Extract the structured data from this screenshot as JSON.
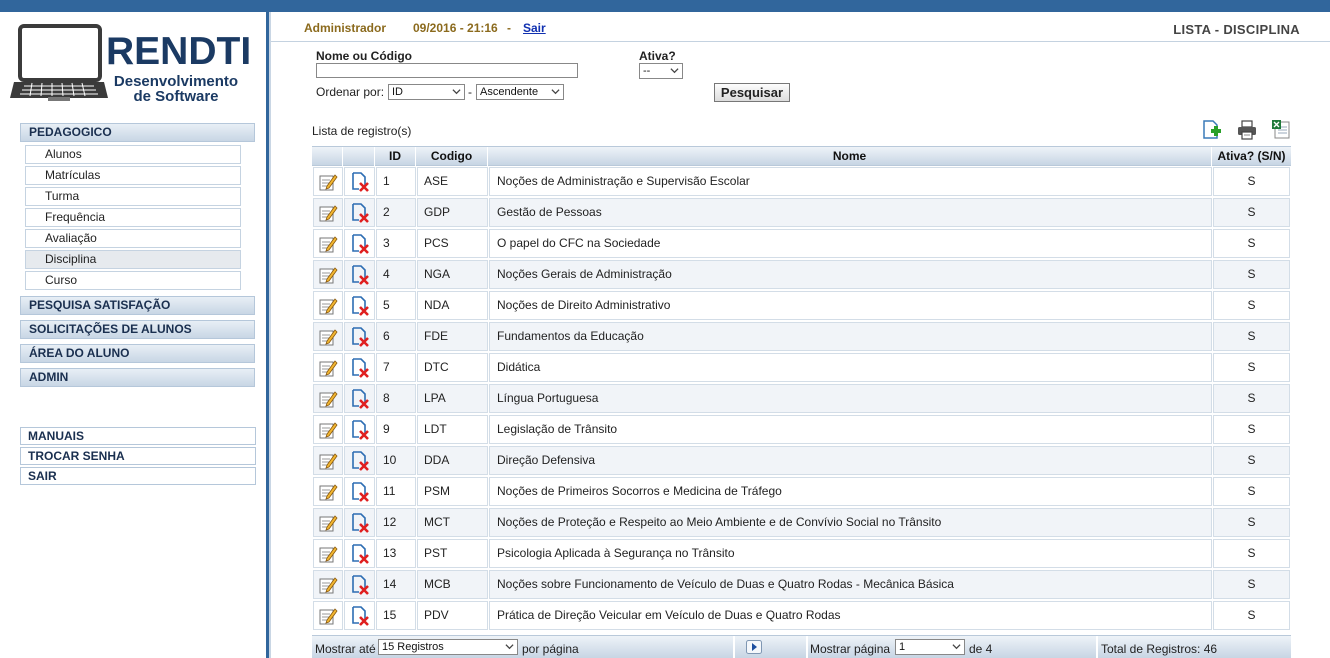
{
  "logo": {
    "title": "RENDTI",
    "subtitle_line1": "Desenvolvimento",
    "subtitle_line2": "de Software"
  },
  "sidebar": {
    "section_pedagogico": "PEDAGOGICO",
    "pedagogico_items": [
      "Alunos",
      "Matrículas",
      "Turma",
      "Frequência",
      "Avaliação",
      "Disciplina",
      "Curso"
    ],
    "active_item": "Disciplina",
    "section_pesquisa": "PESQUISA SATISFAÇÃO",
    "section_solicitacoes": "SOLICITAÇÕES DE ALUNOS",
    "section_area": "ÁREA DO ALUNO",
    "section_admin": "ADMIN",
    "bottom": [
      "MANUAIS",
      "TROCAR SENHA",
      "SAIR"
    ]
  },
  "topbar": {
    "user": "Administrador",
    "date": "09/2016 - 21:16",
    "separator": "-",
    "logout": "Sair",
    "page_title": "LISTA - DISCIPLINA"
  },
  "filters": {
    "name_label": "Nome ou Código",
    "name_value": "",
    "ativa_label": "Ativa?",
    "ativa_value": "--",
    "order_label": "Ordenar por:",
    "order_field": "ID",
    "order_sep": "-",
    "order_dir": "Ascendente",
    "search_button": "Pesquisar"
  },
  "list_caption": "Lista de registro(s)",
  "toolbar_icons": [
    "add-icon",
    "print-icon",
    "excel-icon"
  ],
  "table": {
    "columns": {
      "id": "ID",
      "codigo": "Codigo",
      "nome": "Nome",
      "ativa": "Ativa? (S/N)"
    },
    "rows": [
      {
        "id": "1",
        "codigo": "ASE",
        "nome": "Noções de Administração e Supervisão Escolar",
        "ativa": "S"
      },
      {
        "id": "2",
        "codigo": "GDP",
        "nome": "Gestão de Pessoas",
        "ativa": "S"
      },
      {
        "id": "3",
        "codigo": "PCS",
        "nome": "O papel do CFC na Sociedade",
        "ativa": "S"
      },
      {
        "id": "4",
        "codigo": "NGA",
        "nome": "Noções Gerais de Administração",
        "ativa": "S"
      },
      {
        "id": "5",
        "codigo": "NDA",
        "nome": "Noções de Direito Administrativo",
        "ativa": "S"
      },
      {
        "id": "6",
        "codigo": "FDE",
        "nome": "Fundamentos da Educação",
        "ativa": "S"
      },
      {
        "id": "7",
        "codigo": "DTC",
        "nome": "Didática",
        "ativa": "S"
      },
      {
        "id": "8",
        "codigo": "LPA",
        "nome": "Língua Portuguesa",
        "ativa": "S"
      },
      {
        "id": "9",
        "codigo": "LDT",
        "nome": "Legislação de Trânsito",
        "ativa": "S"
      },
      {
        "id": "10",
        "codigo": "DDA",
        "nome": "Direção Defensiva",
        "ativa": "S"
      },
      {
        "id": "11",
        "codigo": "PSM",
        "nome": "Noções de Primeiros Socorros e Medicina de Tráfego",
        "ativa": "S"
      },
      {
        "id": "12",
        "codigo": "MCT",
        "nome": "Noções de Proteção e Respeito ao Meio Ambiente e de Convívio Social no Trânsito",
        "ativa": "S"
      },
      {
        "id": "13",
        "codigo": "PST",
        "nome": "Psicologia Aplicada à Segurança no Trânsito",
        "ativa": "S"
      },
      {
        "id": "14",
        "codigo": "MCB",
        "nome": "Noções sobre Funcionamento de Veículo de Duas e Quatro Rodas - Mecânica Básica",
        "ativa": "S"
      },
      {
        "id": "15",
        "codigo": "PDV",
        "nome": "Prática de Direção Veicular em Veículo de Duas e Quatro Rodas",
        "ativa": "S"
      }
    ]
  },
  "pager": {
    "show_up_to": "Mostrar até",
    "per_page_value": "15 Registros",
    "per_page_suffix": "por página",
    "show_page": "Mostrar página",
    "page_value": "1",
    "of_pages": "de 4",
    "total": "Total de Registros: 46"
  },
  "colors": {
    "frame": "#31669c",
    "header_gradient_bottom": "#c7d5e4",
    "logo_text": "#1b3a63",
    "user_text": "#8b6a1d",
    "link": "#1030b0",
    "delete_x": "#e02020"
  }
}
